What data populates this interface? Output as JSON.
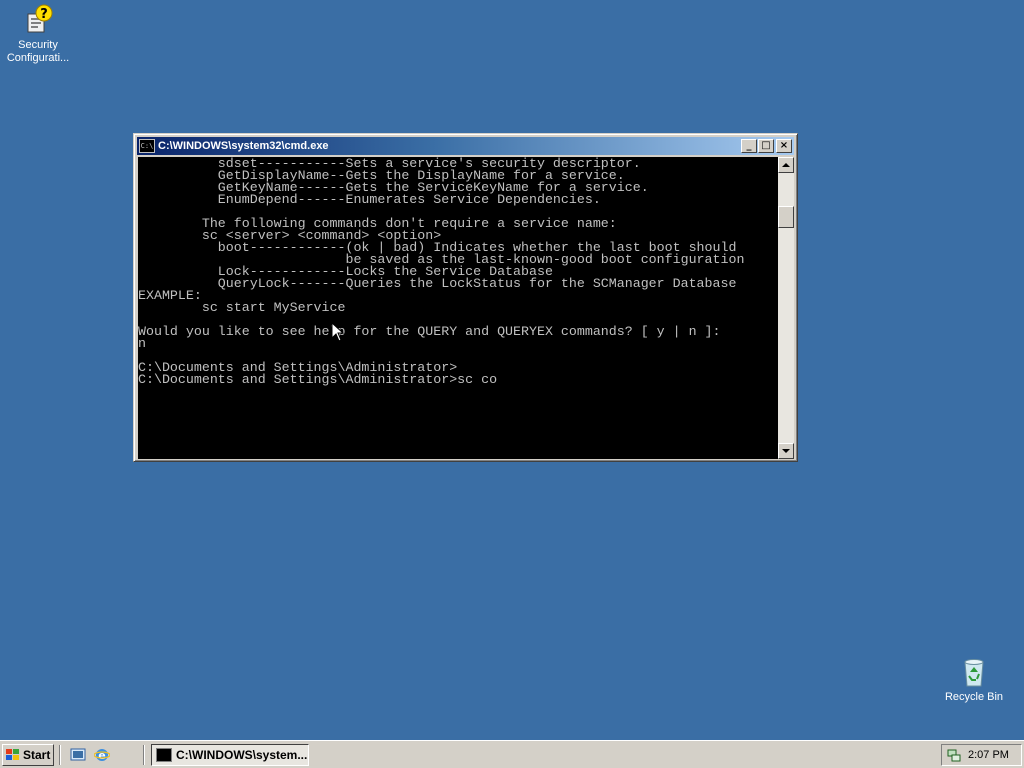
{
  "desktop": {
    "icons": [
      {
        "label_line1": "Security",
        "label_line2": "Configurati...",
        "icon": "security-config-icon"
      },
      {
        "label_line1": "Recycle Bin",
        "icon": "recycle-bin-icon"
      }
    ]
  },
  "window": {
    "title": "C:\\WINDOWS\\system32\\cmd.exe",
    "controls": {
      "minimize": "_",
      "maximize": "□",
      "close": "×"
    },
    "console_lines": [
      "          sdset-----------Sets a service's security descriptor.",
      "          GetDisplayName--Gets the DisplayName for a service.",
      "          GetKeyName------Gets the ServiceKeyName for a service.",
      "          EnumDepend------Enumerates Service Dependencies.",
      "",
      "        The following commands don't require a service name:",
      "        sc <server> <command> <option>",
      "          boot------------(ok | bad) Indicates whether the last boot should",
      "                          be saved as the last-known-good boot configuration",
      "          Lock------------Locks the Service Database",
      "          QueryLock-------Queries the LockStatus for the SCManager Database",
      "EXAMPLE:",
      "        sc start MyService",
      "",
      "Would you like to see help for the QUERY and QUERYEX commands? [ y | n ]:",
      "n",
      "",
      "C:\\Documents and Settings\\Administrator>",
      "C:\\Documents and Settings\\Administrator>sc co"
    ]
  },
  "taskbar": {
    "start_label": "Start",
    "task_label": "C:\\WINDOWS\\system...",
    "clock": "2:07 PM"
  },
  "colors": {
    "desktop": "#3a6ea5",
    "title_active_start": "#0a246a",
    "title_active_end": "#a6caf0",
    "console_bg": "#000000",
    "console_fg": "#c0c0c0",
    "chrome": "#d4d0c8"
  }
}
